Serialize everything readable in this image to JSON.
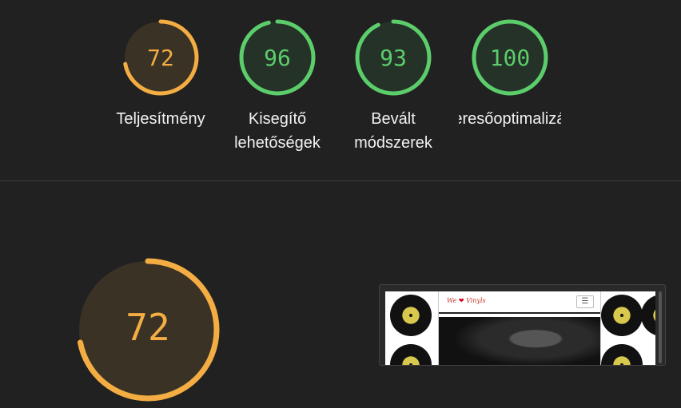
{
  "colors": {
    "average": "#f4ad42",
    "average_bg": "#3b3226",
    "pass": "#5ccd6b",
    "pass_bg": "#253228"
  },
  "gauges": [
    {
      "score": 72,
      "label": "Teljesítmény",
      "rating": "average"
    },
    {
      "score": 96,
      "label": "Kisegítő lehetőségek",
      "rating": "pass"
    },
    {
      "score": 93,
      "label": "Bevált módszerek",
      "rating": "pass"
    },
    {
      "score": 100,
      "label": "Keresőoptimalizálás",
      "rating": "pass"
    }
  ],
  "main_gauge": {
    "score": 72,
    "rating": "average"
  },
  "preview": {
    "logo_text_left": "We",
    "logo_text_right": "Vinyls",
    "menu_icon": "hamburger-icon"
  }
}
